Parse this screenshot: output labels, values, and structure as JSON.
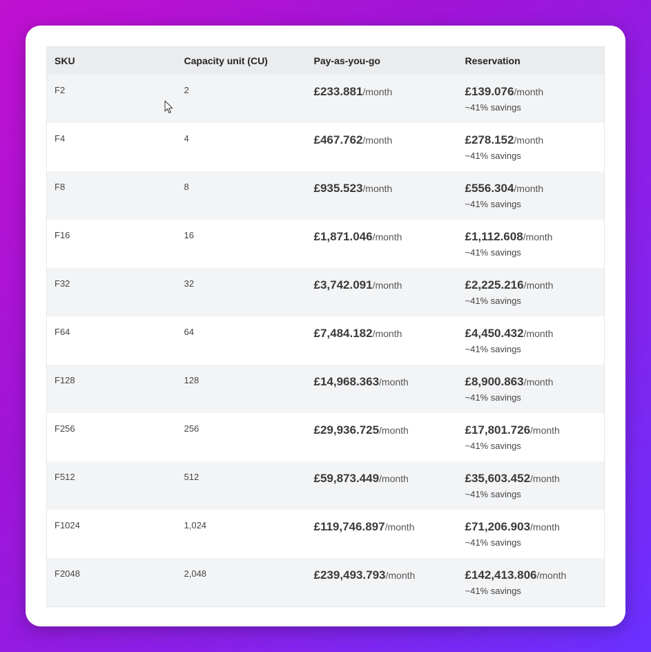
{
  "table": {
    "headers": {
      "sku": "SKU",
      "cu": "Capacity unit (CU)",
      "payg": "Pay-as-you-go",
      "reservation": "Reservation"
    },
    "rows": [
      {
        "sku": "F2",
        "cu": "2",
        "payg_price": "£233.881",
        "payg_unit": "/month",
        "res_price": "£139.076",
        "res_unit": "/month",
        "savings": "~41% savings"
      },
      {
        "sku": "F4",
        "cu": "4",
        "payg_price": "£467.762",
        "payg_unit": "/month",
        "res_price": "£278.152",
        "res_unit": "/month",
        "savings": "~41% savings"
      },
      {
        "sku": "F8",
        "cu": "8",
        "payg_price": "£935.523",
        "payg_unit": "/month",
        "res_price": "£556.304",
        "res_unit": "/month",
        "savings": "~41% savings"
      },
      {
        "sku": "F16",
        "cu": "16",
        "payg_price": "£1,871.046",
        "payg_unit": "/month",
        "res_price": "£1,112.608",
        "res_unit": "/month",
        "savings": "~41% savings"
      },
      {
        "sku": "F32",
        "cu": "32",
        "payg_price": "£3,742.091",
        "payg_unit": "/month",
        "res_price": "£2,225.216",
        "res_unit": "/month",
        "savings": "~41% savings"
      },
      {
        "sku": "F64",
        "cu": "64",
        "payg_price": "£7,484.182",
        "payg_unit": "/month",
        "res_price": "£4,450.432",
        "res_unit": "/month",
        "savings": "~41% savings"
      },
      {
        "sku": "F128",
        "cu": "128",
        "payg_price": "£14,968.363",
        "payg_unit": "/month",
        "res_price": "£8,900.863",
        "res_unit": "/month",
        "savings": "~41% savings"
      },
      {
        "sku": "F256",
        "cu": "256",
        "payg_price": "£29,936.725",
        "payg_unit": "/month",
        "res_price": "£17,801.726",
        "res_unit": "/month",
        "savings": "~41% savings"
      },
      {
        "sku": "F512",
        "cu": "512",
        "payg_price": "£59,873.449",
        "payg_unit": "/month",
        "res_price": "£35,603.452",
        "res_unit": "/month",
        "savings": "~41% savings"
      },
      {
        "sku": "F1024",
        "cu": "1,024",
        "payg_price": "£119,746.897",
        "payg_unit": "/month",
        "res_price": "£71,206.903",
        "res_unit": "/month",
        "savings": "~41% savings"
      },
      {
        "sku": "F2048",
        "cu": "2,048",
        "payg_price": "£239,493.793",
        "payg_unit": "/month",
        "res_price": "£142,413.806",
        "res_unit": "/month",
        "savings": "~41% savings"
      }
    ]
  },
  "colors": {
    "background_start": "#c010d0",
    "background_end": "#6a30ff",
    "header_bg": "#ebecee",
    "row_alt_bg": "#f3f4f6"
  },
  "icons": {
    "cursor": "mouse-pointer-icon"
  }
}
